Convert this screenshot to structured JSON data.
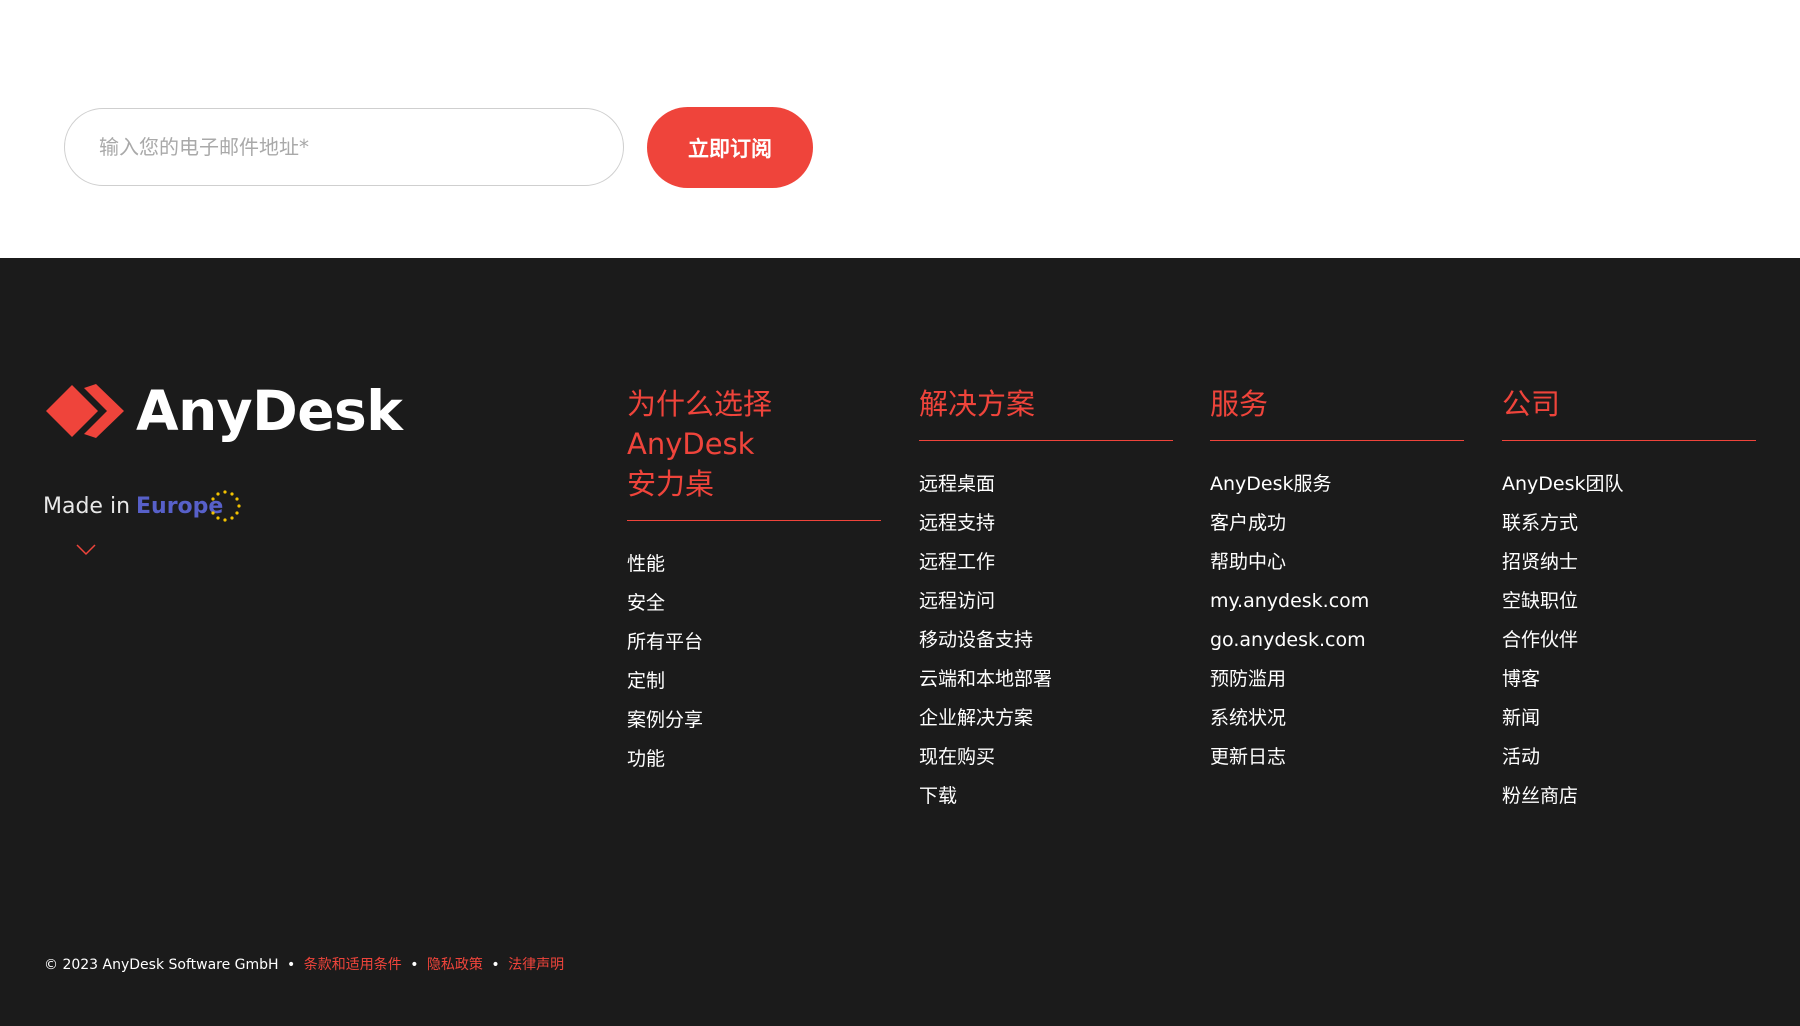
{
  "subscribe": {
    "email_placeholder": "输入您的电子邮件地址*",
    "email_value": "",
    "button_label": "立即订阅",
    "accent_color": "#ef443b"
  },
  "footer": {
    "background_color": "#1b1b1b",
    "logo": {
      "wordmark": "AnyDesk",
      "icon": "anydesk-diamond-logo-icon"
    },
    "made_in": {
      "prefix": "Made in",
      "region": "Europe",
      "icon": "eu-stars-icon"
    },
    "expand_icon": "chevron-down-icon",
    "columns": [
      {
        "title_line1": "为什么选择AnyDesk",
        "title_line2": "安力桌",
        "items": [
          "性能",
          "安全",
          "所有平台",
          "定制",
          "案例分享",
          "功能"
        ]
      },
      {
        "title_line1": "解决方案",
        "title_line2": "",
        "items": [
          "远程桌面",
          "远程支持",
          "远程工作",
          "远程访问",
          "移动设备支持",
          "云端和本地部署",
          "企业解决方案",
          "现在购买",
          "下载"
        ]
      },
      {
        "title_line1": "服务",
        "title_line2": "",
        "items": [
          "AnyDesk服务",
          "客户成功",
          "帮助中心",
          "my.anydesk.com",
          "go.anydesk.com",
          "预防滥用",
          "系统状况",
          "更新日志"
        ]
      },
      {
        "title_line1": "公司",
        "title_line2": "",
        "items": [
          "AnyDesk团队",
          "联系方式",
          "招贤纳士",
          "空缺职位",
          "合作伙伴",
          "博客",
          "新闻",
          "活动",
          "粉丝商店"
        ]
      }
    ],
    "bottom": {
      "copyright": "© 2023 AnyDesk Software GmbH",
      "separator": "•",
      "links": [
        "条款和适用条件",
        "隐私政策",
        "法律声明"
      ]
    }
  }
}
